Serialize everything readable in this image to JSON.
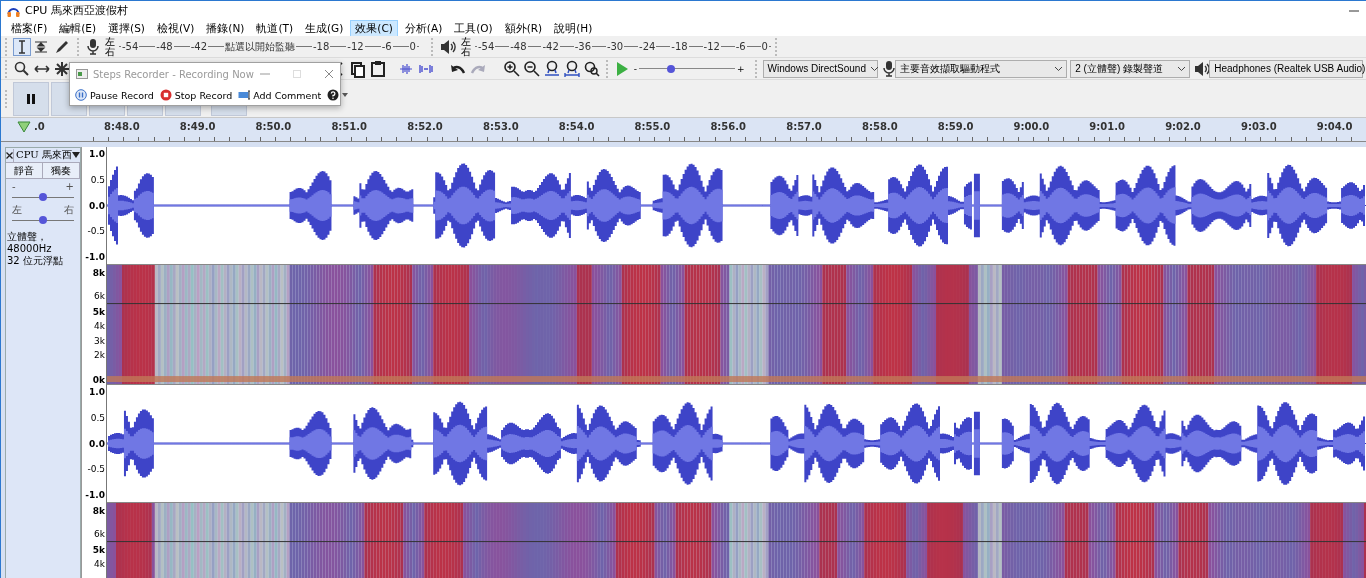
{
  "window": {
    "title": "CPU 馬來西亞渡假村"
  },
  "menu": [
    {
      "label": "檔案(F)",
      "selected": false
    },
    {
      "label": "編輯(E)",
      "selected": false
    },
    {
      "label": "選擇(S)",
      "selected": false
    },
    {
      "label": "檢視(V)",
      "selected": false
    },
    {
      "label": "播錄(N)",
      "selected": false
    },
    {
      "label": "軌道(T)",
      "selected": false
    },
    {
      "label": "生成(G)",
      "selected": false
    },
    {
      "label": "效果(C)",
      "selected": true
    },
    {
      "label": "分析(A)",
      "selected": false
    },
    {
      "label": "工具(O)",
      "selected": false
    },
    {
      "label": "額外(R)",
      "selected": false
    },
    {
      "label": "說明(H)",
      "selected": false
    }
  ],
  "toolbar": {
    "tools": [
      {
        "kind": "select",
        "selected": true
      },
      {
        "kind": "envelope",
        "selected": false
      },
      {
        "kind": "draw",
        "selected": false
      },
      {
        "kind": "zoom",
        "selected": false
      },
      {
        "kind": "timeshift",
        "selected": false
      },
      {
        "kind": "multi",
        "selected": false
      }
    ],
    "record_meter": {
      "channels": [
        "左",
        "右"
      ],
      "ticks": [
        "-54",
        "-48",
        "-42",
        "點選以開始監聽",
        "-18",
        "-12",
        "-6",
        "0"
      ]
    },
    "playback_meter": {
      "channels": [
        "左",
        "右"
      ],
      "ticks": [
        "-54",
        "-48",
        "-42",
        "-36",
        "-30",
        "-24",
        "-18",
        "-12",
        "-6",
        "0"
      ]
    },
    "play_speed": {
      "min": "-",
      "max": "+",
      "level": 0.33
    },
    "devices": [
      {
        "kind": "host",
        "value": "Windows DirectSound"
      },
      {
        "kind": "input",
        "value": "主要音效擷取驅動程式"
      },
      {
        "kind": "channels",
        "value": "2 (立體聲) 錄製聲道"
      },
      {
        "kind": "output",
        "value": "Headphones (Realtek USB Audio)"
      }
    ]
  },
  "steps_recorder": {
    "title": "Steps Recorder - Recording Now",
    "buttons": [
      {
        "kind": "pause",
        "label": "Pause Record"
      },
      {
        "kind": "stop",
        "label": "Stop Record"
      },
      {
        "kind": "comment",
        "label": "Add Comment"
      }
    ]
  },
  "timeline": {
    "labels": [
      ".0",
      "8:48.0",
      "8:49.0",
      "8:50.0",
      "8:51.0",
      "8:52.0",
      "8:53.0",
      "8:54.0",
      "8:55.0",
      "8:56.0",
      "8:57.0",
      "8:58.0",
      "8:59.0",
      "9:00.0",
      "9:01.0",
      "9:02.0",
      "9:03.0",
      "9:04.0"
    ]
  },
  "track": {
    "name": "CPU 馬來西",
    "buttons": [
      "靜音",
      "獨奏"
    ],
    "gain": {
      "min": "-",
      "max": "+",
      "level": 0.5
    },
    "pan": {
      "min": "左",
      "max": "右",
      "level": 0.5
    },
    "info": [
      "立體聲，48000Hz",
      "32 位元浮點"
    ],
    "channels": [
      {
        "wave_ticks": [
          "1.0",
          "0.5",
          "0.0",
          "-0.5",
          "-1.0"
        ],
        "spectrum_ticks": [
          "8k",
          "6k",
          "5k",
          "4k",
          "3k",
          "2k",
          "0k"
        ]
      },
      {
        "wave_ticks": [
          "1.0",
          "0.5",
          "0.0",
          "-0.5",
          "-1.0"
        ],
        "spectrum_ticks": [
          "8k",
          "6k",
          "5k",
          "4k"
        ]
      }
    ]
  }
}
